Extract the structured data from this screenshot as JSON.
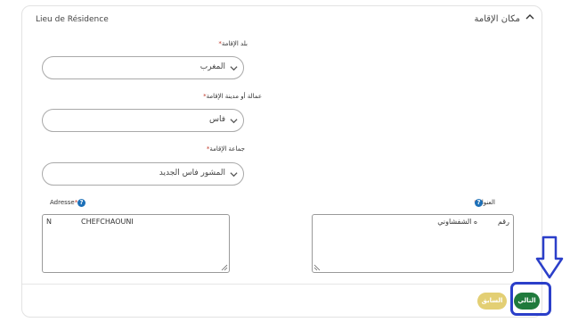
{
  "panel": {
    "title_fr": "Lieu de Résidence",
    "title_ar": "مكان الإقامة"
  },
  "fields": {
    "country": {
      "label": "بلد الإقامة",
      "required": "*",
      "value": "المغرب"
    },
    "prefecture": {
      "label": "عمالة أو مدينة الإقامة",
      "required": "*",
      "value": "فاس"
    },
    "commune": {
      "label": "جماعة الإقامة",
      "required": "*",
      "value": "المشور فاس الجديد"
    },
    "address_fr": {
      "label": "Adresse",
      "required": "*",
      "help": "?",
      "value": "N             CHEFCHAOUNI"
    },
    "address_ar": {
      "label": "العنوان",
      "required": "*",
      "help": "?",
      "value": "رقم         ه الشفشاوني"
    }
  },
  "buttons": {
    "previous": "السابق",
    "next": "التالي"
  },
  "colors": {
    "next_button": "#1f7a3c",
    "previous_button": "#e3cf74",
    "annotation": "#2b3fc9",
    "help_icon": "#1d70b8"
  }
}
